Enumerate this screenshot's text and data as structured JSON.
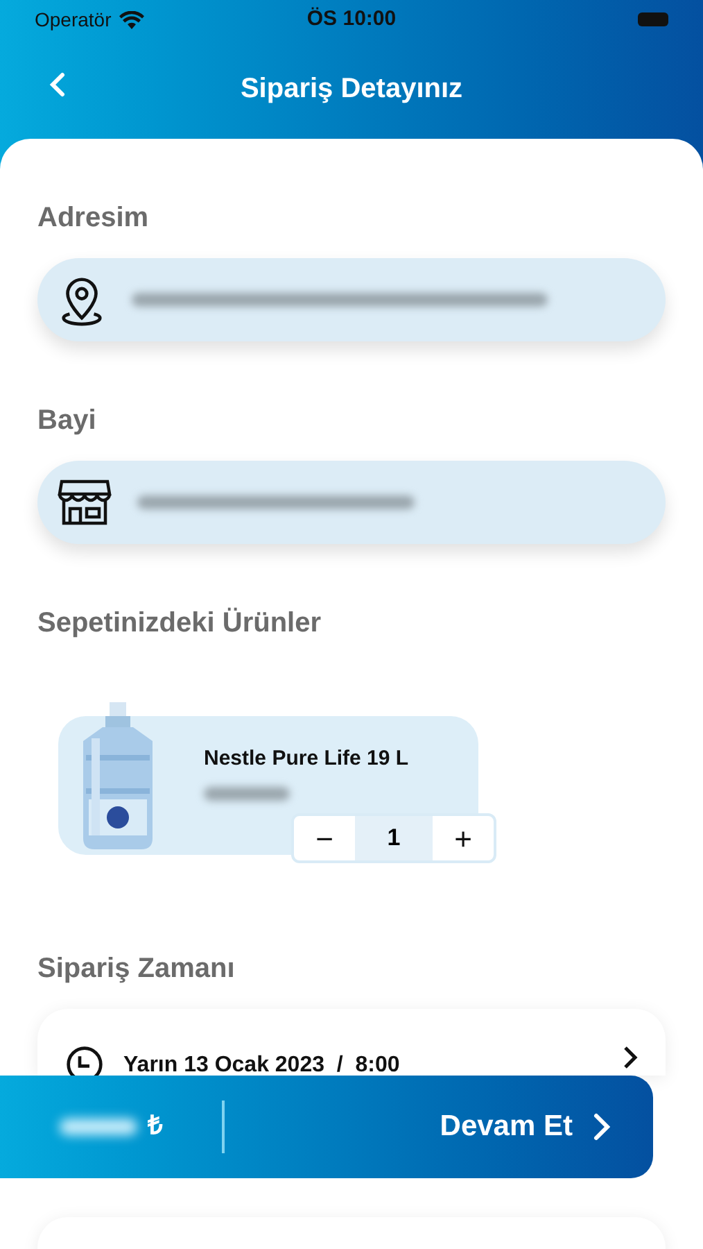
{
  "status_bar": {
    "carrier": "Operatör",
    "time": "ÖS 10:00"
  },
  "header": {
    "title": "Sipariş Detayınız"
  },
  "sections": [
    {
      "kind": "address",
      "title": "Adresim"
    },
    {
      "kind": "dealer",
      "title": "Bayi"
    }
  ],
  "cart": {
    "title": "Sepetinizdeki Ürünler",
    "items": [
      {
        "name": "Nestle Pure Life 19 L",
        "minus": "−",
        "quantity": "1",
        "plus": "+"
      }
    ]
  },
  "order_time": {
    "title": "Sipariş Zamanı",
    "value": "Yarın 13 Ocak 2023  /  8:00"
  },
  "payment": {
    "kind": "card"
  },
  "bottom_bar": {
    "currency": "₺",
    "action": "Devam Et"
  }
}
